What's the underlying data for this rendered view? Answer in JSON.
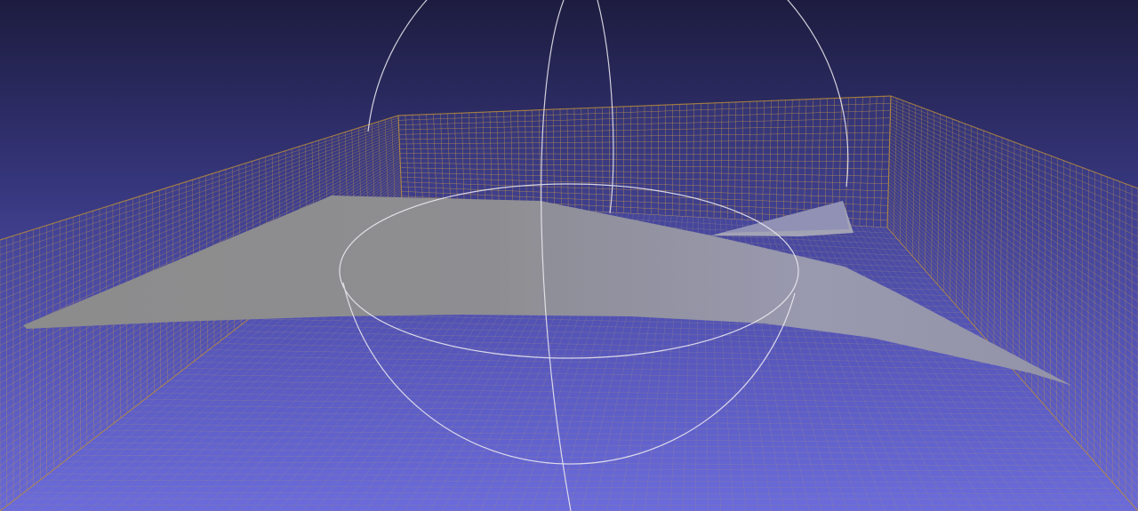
{
  "viewport": {
    "background_top": "#1d1c3f",
    "background_bottom": "#6e6ede",
    "grid_line_color": "#c59a4a",
    "grid_line_dense_color": "#9a8a8a",
    "surface_color": "#8a8a8a",
    "surface_light_color": "#a8a8b4",
    "trackball_color": "#f0eef4"
  },
  "objects": [
    {
      "name": "container-walls",
      "icon": "grid-mesh"
    },
    {
      "name": "free-surface-mesh",
      "icon": "surface-mesh"
    },
    {
      "name": "trackball",
      "icon": "trackball-rings"
    }
  ]
}
